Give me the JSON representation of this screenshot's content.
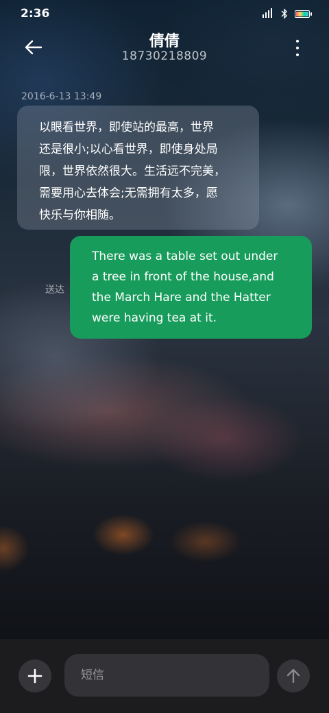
{
  "status_bar": {
    "time": "2:36",
    "icons": [
      "signal-icon",
      "bluetooth-icon",
      "battery-icon"
    ]
  },
  "header": {
    "contact_name": "倩倩",
    "contact_number": "18730218809",
    "back_icon": "back-arrow-icon",
    "more_icon": "more-vertical-icon"
  },
  "conversation": {
    "timestamp": "2016-6-13 13:49",
    "messages": [
      {
        "direction": "incoming",
        "text": "以眼看世界，即使站的最高，世界\n还是很小;以心看世界，即使身处局\n限，世界依然很大。生活远不完美，\n需要用心去体会;无需拥有太多，愿\n快乐与你相随。"
      },
      {
        "direction": "outgoing",
        "status": "送达",
        "text": "There was a table set out under\na tree in front of the house,and\nthe March Hare and the Hatter\nwere having tea at it.",
        "bubble_color": "#189c5c"
      }
    ]
  },
  "composer": {
    "placeholder": "短信",
    "add_icon": "plus-icon",
    "send_icon": "arrow-up-icon"
  }
}
